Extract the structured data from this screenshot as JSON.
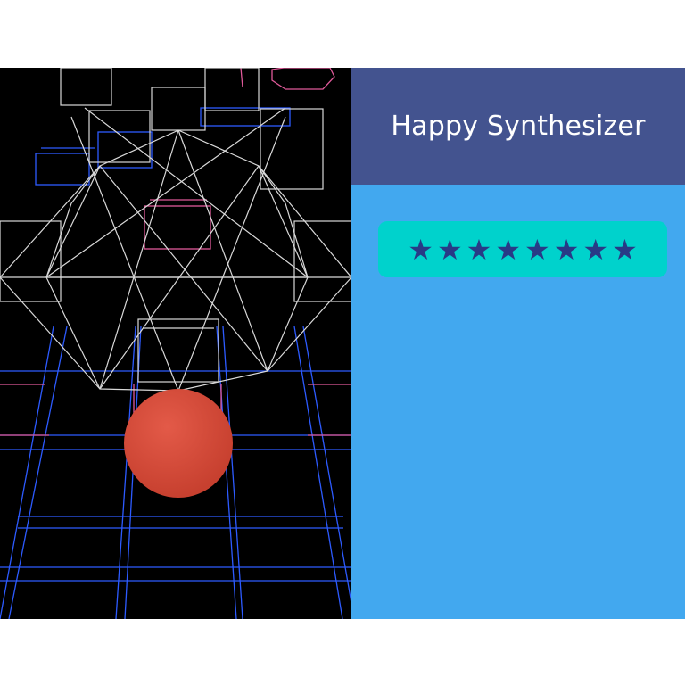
{
  "game": {
    "title": "Happy Synthesizer",
    "rating": {
      "value": 8,
      "max": 8,
      "icon": "star-icon"
    },
    "colors": {
      "background": "#000000",
      "wireframe_white": "#d9d9d9",
      "wireframe_blue": "#2d5bff",
      "wireframe_pink": "#e05a9a",
      "ball": "#d94c3c",
      "title_bar": "#43538f",
      "panel": "#42a8ef",
      "badge": "#00d2cc",
      "star": "#283a86"
    }
  }
}
